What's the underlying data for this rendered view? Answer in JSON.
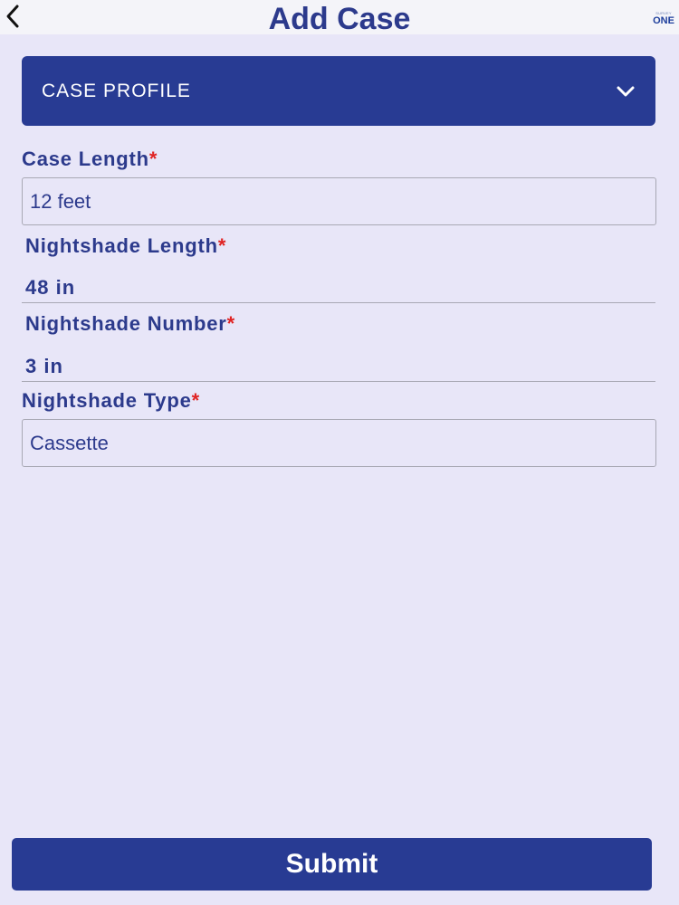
{
  "header": {
    "title": "Add Case",
    "back_icon": "chevron-left-icon",
    "logo": {
      "small_text": "SURVEY",
      "big_text": "ONE"
    }
  },
  "profile_section": {
    "label": "CASE PROFILE",
    "toggle_icon": "chevron-down-icon"
  },
  "fields": {
    "case_length": {
      "label": "Case Length",
      "required_mark": "*",
      "value": "12 feet"
    },
    "nightshade_length": {
      "label": "Nightshade Length",
      "required_mark": "*",
      "value": "48 in"
    },
    "nightshade_number": {
      "label": "Nightshade Number",
      "required_mark": "*",
      "value": "3 in"
    },
    "nightshade_type": {
      "label": "Nightshade Type",
      "required_mark": "*",
      "value": "Cassette"
    }
  },
  "submit": {
    "label": "Submit"
  },
  "colors": {
    "background": "#e8e6f8",
    "primary": "#283b93",
    "text": "#2c3a8c",
    "required": "#e02424"
  }
}
